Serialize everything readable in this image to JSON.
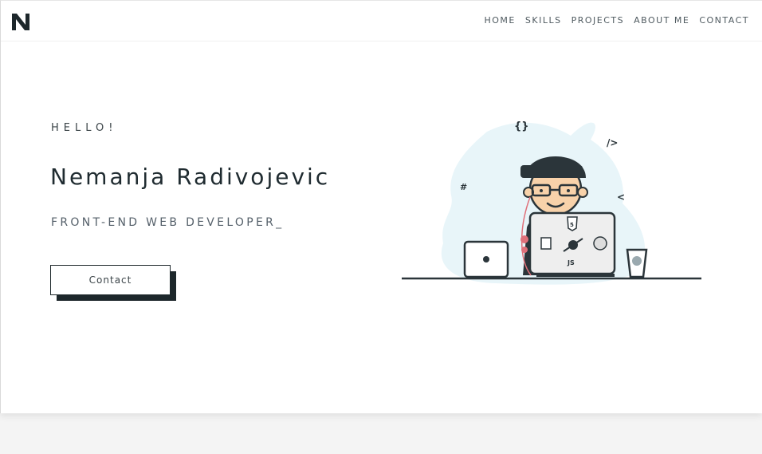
{
  "brand": {
    "logo_letter": "N"
  },
  "nav": {
    "items": [
      "HOME",
      "SKILLS",
      "PROJECTS",
      "ABOUT ME",
      "CONTACT"
    ]
  },
  "hero": {
    "greeting": "HELLO!",
    "name": "Nemanja Radivojevic",
    "role": "FRONT-END WEB DEVELOPER_",
    "cta_label": "Contact"
  },
  "illustration": {
    "symbols": [
      "{}",
      "/>",
      "#",
      "<"
    ],
    "laptop_badges": [
      "5",
      "JS"
    ]
  },
  "colors": {
    "accent": "#1d272b",
    "blob": "#e8f5f9",
    "page_bg": "#f4f4f4"
  }
}
